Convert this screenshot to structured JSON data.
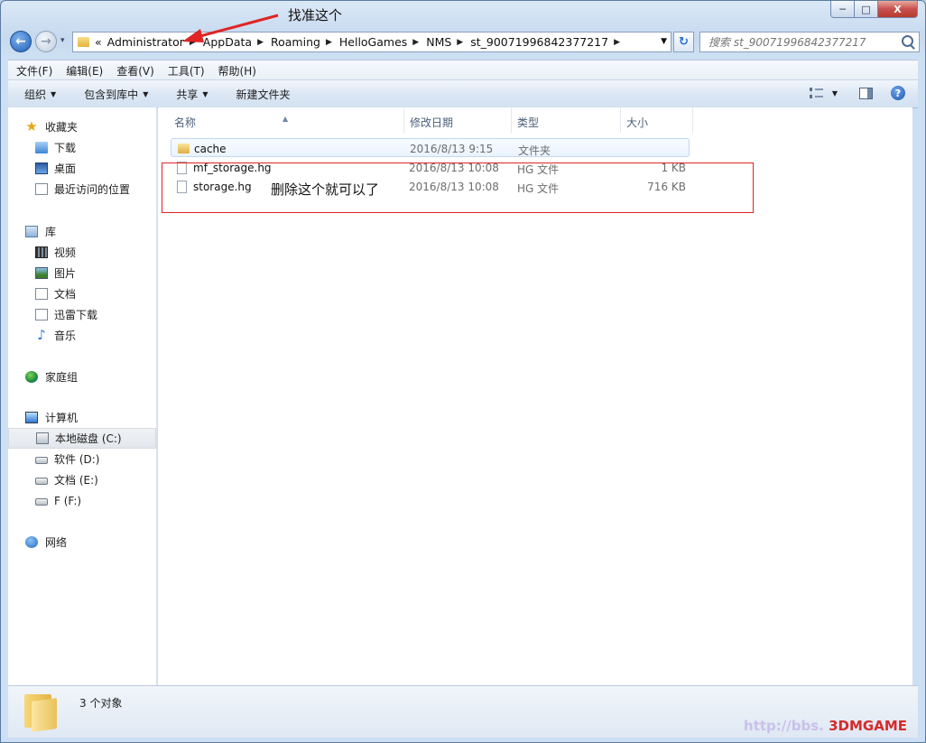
{
  "window": {
    "caption_min": "─",
    "caption_max": "□",
    "caption_close": "X"
  },
  "nav": {
    "back_glyph": "←",
    "fwd_glyph": "→",
    "history_glyph": "▾",
    "address_overflow": "«",
    "breadcrumbs": [
      "Administrator",
      "AppData",
      "Roaming",
      "HelloGames",
      "NMS",
      "st_90071996842377217"
    ],
    "crumb_sep": "▶",
    "address_dropdown": "▼",
    "refresh_glyph": "↻",
    "search_placeholder": "搜索 st_90071996842377217"
  },
  "menubar": [
    "文件(F)",
    "编辑(E)",
    "查看(V)",
    "工具(T)",
    "帮助(H)"
  ],
  "commands": {
    "organize": "组织",
    "include_library": "包含到库中",
    "share": "共享",
    "new_folder": "新建文件夹",
    "dropdown": "▼",
    "help": "?"
  },
  "sidebar": {
    "favorites": {
      "label": "收藏夹",
      "items": [
        "下载",
        "桌面",
        "最近访问的位置"
      ]
    },
    "libraries": {
      "label": "库",
      "items": [
        "视频",
        "图片",
        "文档",
        "迅雷下载",
        "音乐"
      ]
    },
    "homegroup": {
      "label": "家庭组"
    },
    "computer": {
      "label": "计算机",
      "items": [
        "本地磁盘 (C:)",
        "软件 (D:)",
        "文档 (E:)",
        "F (F:)"
      ]
    },
    "network": {
      "label": "网络"
    },
    "star_glyph": "★",
    "music_glyph": "♪"
  },
  "columns": {
    "name": "名称",
    "date": "修改日期",
    "type": "类型",
    "size": "大小",
    "sort_glyph": "▲"
  },
  "files": [
    {
      "name": "cache",
      "date": "2016/8/13 9:15",
      "type": "文件夹",
      "size": ""
    },
    {
      "name": "mf_storage.hg",
      "date": "2016/8/13 10:08",
      "type": "HG 文件",
      "size": "1 KB"
    },
    {
      "name": "storage.hg",
      "date": "2016/8/13 10:08",
      "type": "HG 文件",
      "size": "716 KB"
    }
  ],
  "annotations": {
    "top": "找准这个",
    "delete_hint": "删除这个就可以了"
  },
  "status": {
    "count": "3 个对象"
  },
  "watermark": {
    "url": "http://bbs.",
    "brand": "3DMGAME"
  },
  "colors": {
    "annotation_red": "#e02424",
    "title_blue": "#1f5fb8"
  }
}
